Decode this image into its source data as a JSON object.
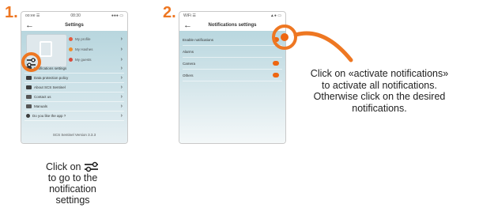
{
  "steps": [
    {
      "number": "1."
    },
    {
      "number": "2."
    }
  ],
  "colors": {
    "accent": "#ee7722",
    "toggle_on": "#ee6611"
  },
  "phone1": {
    "status": {
      "carrier": "oo:ee ☰",
      "time": "08:30",
      "battery": "●●● ▭"
    },
    "title": "Settings",
    "profile_menu": [
      {
        "label": "My profile",
        "dot_color": "#e65a3c"
      },
      {
        "label": "My Hashes",
        "dot_color": "#f28c2b"
      },
      {
        "label": "My guests",
        "dot_color": "#d94a3a"
      }
    ],
    "menu_items": [
      {
        "label": "Notifications settings",
        "icon": "sliders-icon"
      },
      {
        "label": "Data protection policy",
        "icon": "document-icon"
      },
      {
        "label": "About SCS Sentinel",
        "icon": "card-icon"
      },
      {
        "label": "Contact us",
        "icon": "monitor-icon"
      },
      {
        "label": "Manuals",
        "icon": "book-icon"
      },
      {
        "label": "Do you like the app ?",
        "icon": "star-icon"
      }
    ],
    "version": "SCS Sentinel Version 3.3.3"
  },
  "phone2": {
    "status": {
      "carrier": "WiFi ☰",
      "time": "",
      "battery": "▲● ▭"
    },
    "title": "Notifications settings",
    "items": [
      {
        "label": "Enable notifications",
        "on": true
      },
      {
        "label": "Alarms",
        "on": false
      },
      {
        "label": "Camera",
        "on": true
      },
      {
        "label": "Others",
        "on": true
      }
    ]
  },
  "captions": {
    "step1": {
      "line1": "Click on",
      "line2": "to go to the",
      "line3": "notification",
      "line4": "settings"
    },
    "step2": {
      "line1": "Click on  «activate notifications»",
      "line2": "to activate all notifications.",
      "line3": "Otherwise click on the desired",
      "line4": "notifications."
    }
  }
}
